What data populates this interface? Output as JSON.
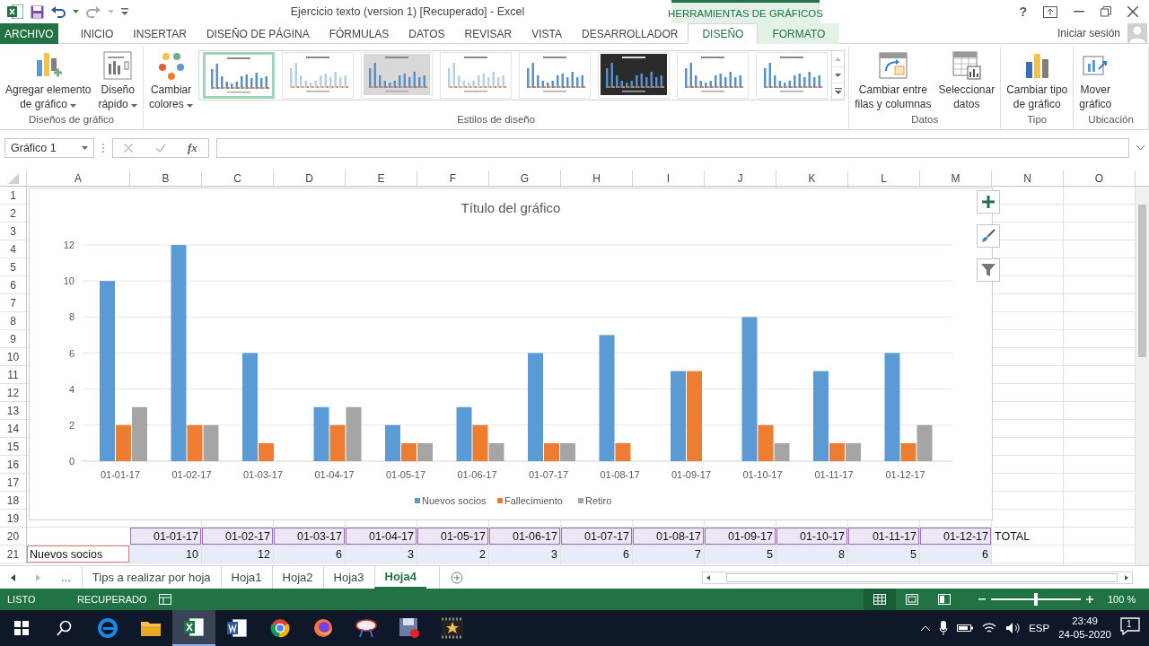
{
  "title_bar": {
    "title": "Ejercicio texto (version 1) [Recuperado] - Excel",
    "context_group": "HERRAMIENTAS DE GRÁFICOS",
    "help": "?"
  },
  "ribbon_tabs": [
    {
      "label": "ARCHIVO",
      "kind": "file",
      "selected": false
    },
    {
      "label": "INICIO",
      "kind": "normal",
      "selected": false
    },
    {
      "label": "INSERTAR",
      "kind": "normal",
      "selected": false
    },
    {
      "label": "DISEÑO DE PÁGINA",
      "kind": "normal",
      "selected": false
    },
    {
      "label": "FÓRMULAS",
      "kind": "normal",
      "selected": false
    },
    {
      "label": "DATOS",
      "kind": "normal",
      "selected": false
    },
    {
      "label": "REVISAR",
      "kind": "normal",
      "selected": false
    },
    {
      "label": "VISTA",
      "kind": "normal",
      "selected": false
    },
    {
      "label": "DESARROLLADOR",
      "kind": "normal",
      "selected": false
    },
    {
      "label": "DISEÑO",
      "kind": "context",
      "selected": true
    },
    {
      "label": "FORMATO",
      "kind": "context",
      "selected": false
    }
  ],
  "account": {
    "label": "Iniciar sesión"
  },
  "ribbon_groups": [
    {
      "label": "Diseños de gráfico",
      "buttons": [
        {
          "lines": [
            "Agregar elemento",
            "de gráfico"
          ],
          "dropdown": true
        },
        {
          "lines": [
            "Diseño",
            "rápido"
          ],
          "dropdown": true
        }
      ]
    },
    {
      "label": "Estilos de diseño",
      "buttons": [
        {
          "lines": [
            "Cambiar",
            "colores"
          ],
          "dropdown": true
        }
      ],
      "gallery": [
        {
          "kind": "light",
          "selected": true
        },
        {
          "kind": "faded",
          "selected": false
        },
        {
          "kind": "gray",
          "selected": false
        },
        {
          "kind": "faded",
          "selected": false
        },
        {
          "kind": "light",
          "selected": false
        },
        {
          "kind": "dark",
          "selected": false
        },
        {
          "kind": "light",
          "selected": false
        },
        {
          "kind": "light",
          "selected": false
        }
      ]
    },
    {
      "label": "Datos",
      "buttons": [
        {
          "lines": [
            "Cambiar entre",
            "filas y columnas"
          ],
          "dropdown": false
        },
        {
          "lines": [
            "Seleccionar",
            "datos"
          ],
          "dropdown": false
        }
      ]
    },
    {
      "label": "Tipo",
      "buttons": [
        {
          "lines": [
            "Cambiar tipo",
            "de gráfico"
          ],
          "dropdown": false
        }
      ]
    },
    {
      "label": "Ubicación",
      "buttons": [
        {
          "lines": [
            "Mover",
            "gráfico"
          ],
          "dropdown": false
        }
      ]
    }
  ],
  "formula_bar": {
    "name_box": "Gráfico 1",
    "fx": "fx"
  },
  "sheet": {
    "columns": [
      "A",
      "B",
      "C",
      "D",
      "E",
      "F",
      "G",
      "H",
      "I",
      "J",
      "K",
      "L",
      "M",
      "N",
      "O"
    ],
    "row_headers": [
      "1",
      "2",
      "3",
      "4",
      "5",
      "6",
      "7",
      "8",
      "9",
      "10",
      "11",
      "12",
      "13",
      "14",
      "15",
      "16",
      "17",
      "18",
      "19",
      "20",
      "21"
    ],
    "header_row": {
      "dates": [
        "01-01-17",
        "01-02-17",
        "01-03-17",
        "01-04-17",
        "01-05-17",
        "01-06-17",
        "01-07-17",
        "01-08-17",
        "01-09-17",
        "01-10-17",
        "01-11-17",
        "01-12-17"
      ],
      "total": "TOTAL"
    },
    "data_row": {
      "label": "Nuevos socios",
      "values": [
        "10",
        "12",
        "6",
        "3",
        "2",
        "3",
        "6",
        "7",
        "5",
        "8",
        "5",
        "6"
      ]
    },
    "chart": {
      "chart_data": {
        "type": "bar",
        "title": "Título del gráfico",
        "categories": [
          "01-01-17",
          "01-02-17",
          "01-03-17",
          "01-04-17",
          "01-05-17",
          "01-06-17",
          "01-07-17",
          "01-08-17",
          "01-09-17",
          "01-10-17",
          "01-11-17",
          "01-12-17"
        ],
        "series": [
          {
            "name": "Nuevos socios",
            "color": "#5b9bd5",
            "values": [
              10,
              12,
              6,
              3,
              2,
              3,
              6,
              7,
              5,
              8,
              5,
              6
            ]
          },
          {
            "name": "Fallecimiento",
            "color": "#ed7d31",
            "values": [
              2,
              2,
              1,
              2,
              1,
              2,
              1,
              1,
              5,
              2,
              1,
              1
            ]
          },
          {
            "name": "Retiro",
            "color": "#a5a5a5",
            "values": [
              3,
              2,
              0,
              3,
              1,
              1,
              1,
              0,
              0,
              1,
              1,
              2
            ]
          }
        ],
        "ylim": [
          0,
          12
        ],
        "yticks": [
          {
            "value": 0,
            "label": "0"
          },
          {
            "value": 2,
            "label": "2"
          },
          {
            "value": 4,
            "label": "4"
          },
          {
            "value": 6,
            "label": "6"
          },
          {
            "value": 8,
            "label": "8"
          },
          {
            "value": 10,
            "label": "10"
          },
          {
            "value": 12,
            "label": "12"
          }
        ],
        "grid": true,
        "legend": true
      }
    }
  },
  "sheet_tabs": {
    "overflow": "...",
    "tabs": [
      {
        "label": "Tips a realizar por hoja",
        "selected": false
      },
      {
        "label": "Hoja1",
        "selected": false
      },
      {
        "label": "Hoja2",
        "selected": false
      },
      {
        "label": "Hoja3",
        "selected": false
      },
      {
        "label": "Hoja4",
        "selected": true
      }
    ]
  },
  "status_bar": {
    "mode": "LISTO",
    "recovery": "RECUPERADO",
    "views": [
      {
        "selected": true
      },
      {
        "selected": false
      },
      {
        "selected": false
      }
    ],
    "zoom": {
      "level": 0.5,
      "reading": "100 %"
    }
  },
  "taskbar": {
    "apps": [
      {
        "active": false
      },
      {
        "active": false
      },
      {
        "active": true
      },
      {
        "active": false
      },
      {
        "active": false
      },
      {
        "active": false
      },
      {
        "active": false
      },
      {
        "active": false
      },
      {
        "active": false
      }
    ],
    "tray": {
      "language": "ESP",
      "time": "23:49",
      "date": "24-05-2020",
      "notifications": "1"
    }
  }
}
